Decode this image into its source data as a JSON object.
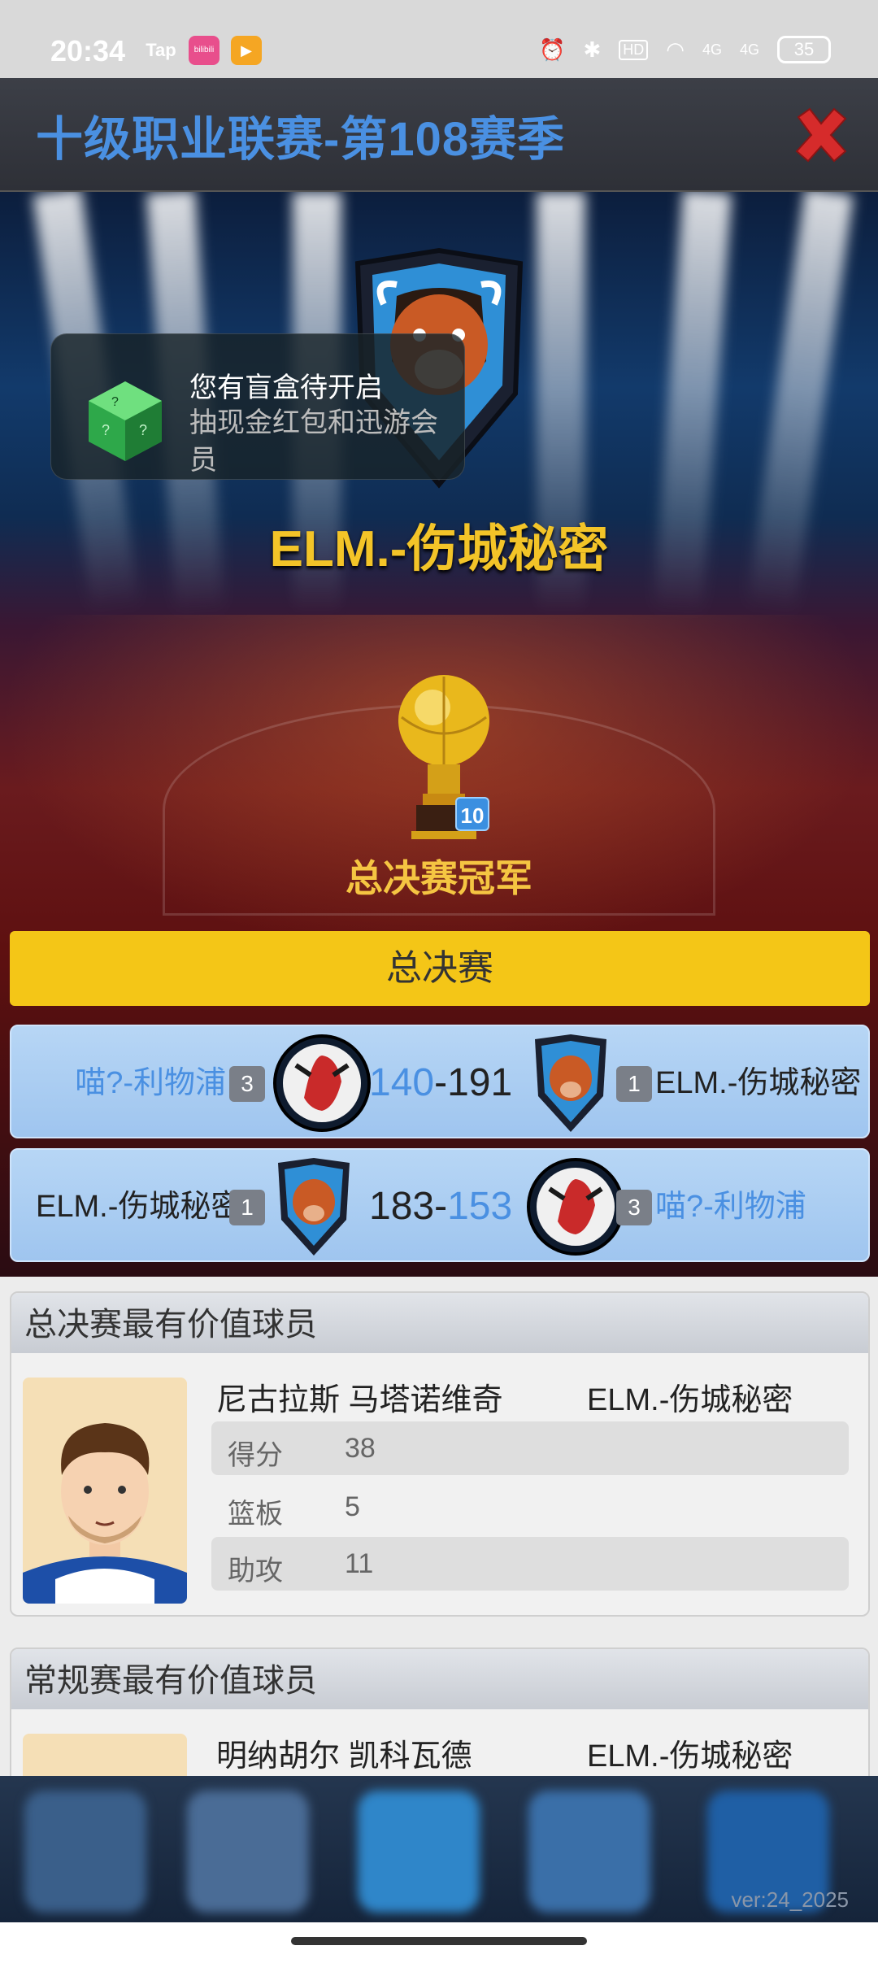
{
  "status_bar": {
    "time": "20:34",
    "app1": "Tap",
    "app2": "bilibili",
    "battery": "35",
    "network": "4G"
  },
  "header": {
    "title": "十级职业联赛-第108赛季"
  },
  "popup": {
    "title": "您有盲盒待开启",
    "subtitle": "抽现金红包和迅游会员"
  },
  "champion": {
    "team_name": "ELM.-伤城秘密",
    "trophy_count": "10",
    "label": "总决赛冠军"
  },
  "finals": {
    "label": "总决赛",
    "matches": [
      {
        "left_team": "喵?-利物浦",
        "left_seed": "3",
        "left_score": "140",
        "sep": "-",
        "right_score": "191",
        "right_seed": "1",
        "right_team": "ELM.-伤城秘密"
      },
      {
        "left_team": "ELM.-伤城秘密",
        "left_seed": "1",
        "left_score": "183",
        "sep": "-",
        "right_score": "153",
        "right_seed": "3",
        "right_team": "喵?-利物浦"
      }
    ]
  },
  "finals_mvp": {
    "heading": "总决赛最有价值球员",
    "player": "尼古拉斯 马塔诺维奇",
    "team": "ELM.-伤城秘密",
    "stats": [
      {
        "label": "得分",
        "value": "38"
      },
      {
        "label": "篮板",
        "value": "5"
      },
      {
        "label": "助攻",
        "value": "11"
      }
    ]
  },
  "regular_mvp": {
    "heading": "常规赛最有价值球员",
    "player": "明纳胡尔 凯科瓦德",
    "team": "ELM.-伤城秘密"
  },
  "footer": {
    "version": "ver:24_2025"
  },
  "colors": {
    "accent_blue": "#4a90e2",
    "gold": "#f3c428",
    "finals_bar": "#f4c617",
    "close_red": "#d62b2b"
  }
}
